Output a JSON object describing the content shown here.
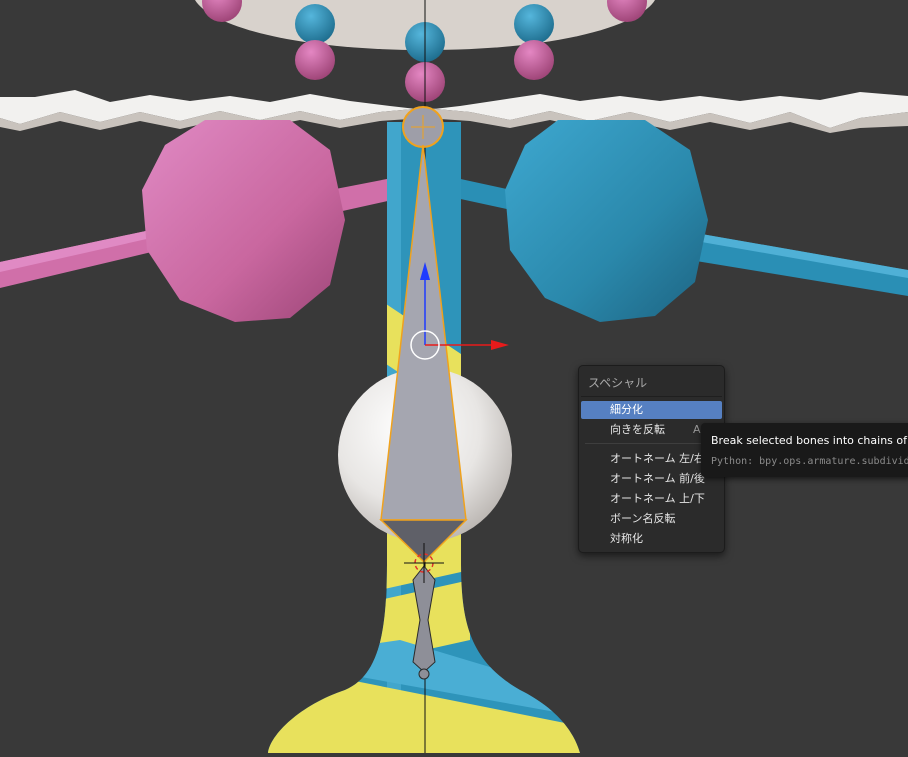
{
  "colors": {
    "background": "#393939",
    "pink": "#d672b0",
    "blue": "#2f93b8",
    "yellow": "#e8e15c",
    "white": "#eeeeee",
    "bone": "#9b9ca7",
    "selected_outline": "#f0a21d",
    "menu_bg": "#2b2b2b",
    "menu_highlight": "#5680c2",
    "tooltip_bg": "#191919"
  },
  "menu": {
    "title": "スペシャル",
    "items": [
      {
        "label": "細分化",
        "shortcut": "",
        "active": true
      },
      {
        "label": "向きを反転",
        "shortcut": "Alt F",
        "active": false
      },
      {
        "label": "オートネーム 左/右",
        "shortcut": "",
        "active": false
      },
      {
        "label": "オートネーム 前/後",
        "shortcut": "",
        "active": false
      },
      {
        "label": "オートネーム 上/下",
        "shortcut": "",
        "active": false
      },
      {
        "label": "ボーン名反転",
        "shortcut": "",
        "active": false
      },
      {
        "label": "対称化",
        "shortcut": "",
        "active": false
      }
    ]
  },
  "tooltip": {
    "description": "Break selected bones into chains of smaller bones",
    "python": "Python: bpy.ops.armature.subdivide()"
  },
  "icons": {
    "manipulator_y": "arrow-up-icon",
    "manipulator_x": "arrow-right-icon",
    "manipulator_center": "circle-icon"
  }
}
